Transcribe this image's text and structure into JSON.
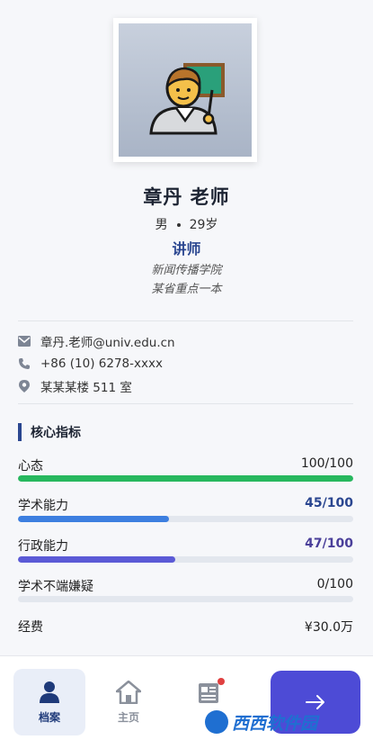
{
  "profile": {
    "name": "章丹 老师",
    "gender": "男",
    "age": "29岁",
    "title": "讲师",
    "college": "新闻传播学院",
    "university": "某省重点一本"
  },
  "contact": {
    "email": "章丹.老师@univ.edu.cn",
    "phone": "+86 (10) 6278-xxxx",
    "office": "某某某楼 511 室"
  },
  "section_title": "核心指标",
  "metrics": [
    {
      "label": "心态",
      "value": "100/100",
      "progress": 1.0,
      "color": "#27b85e"
    },
    {
      "label": "学术能力",
      "value": "45/100",
      "progress": 0.45,
      "color": "#3d7fe0"
    },
    {
      "label": "行政能力",
      "value": "47/100",
      "progress": 0.47,
      "color": "#5b5ad6"
    },
    {
      "label": "学术不端嫌疑",
      "value": "0/100",
      "progress": 0.0,
      "color": "#e45050"
    }
  ],
  "funds": {
    "label": "经费",
    "value": "¥30.0万"
  },
  "nav": {
    "profile_label": "档案",
    "home_label": "主页"
  },
  "watermark": "西西软件园",
  "colors": {
    "accent": "#2a4690",
    "button": "#4d4bd6"
  }
}
